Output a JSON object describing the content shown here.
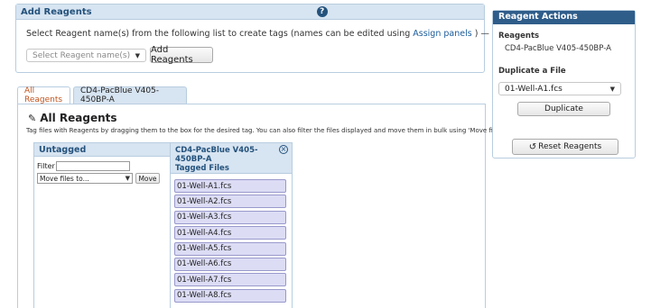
{
  "add_panel": {
    "title": "Add Reagents",
    "help_icon": "?",
    "instruction_prefix": "Select Reagent name(s) from the following list to create tags (names can be edited using ",
    "instruction_link": "Assign panels",
    "instruction_suffix": " ) —",
    "select_placeholder": "Select Reagent name(s)",
    "add_button": "Add Reagents"
  },
  "tabs": [
    {
      "label": "All Reagents",
      "active": true
    },
    {
      "label": "CD4-PacBlue V405-450BP-A",
      "active": false
    }
  ],
  "main": {
    "title": "All Reagents",
    "description": "Tag files with Reagents by dragging them to the box for the desired tag. You can also filter the files displayed and move them in bulk using 'Move files to...'.",
    "untagged": {
      "title": "Untagged",
      "filter_label": "Filter",
      "filter_value": "",
      "move_select": "Move files to...",
      "move_button": "Move"
    },
    "tagged": {
      "title_line1": "CD4-PacBlue V405-450BP-A",
      "title_line2": "Tagged Files",
      "close_icon": "⊗",
      "files": [
        "01-Well-A1.fcs",
        "01-Well-A2.fcs",
        "01-Well-A3.fcs",
        "01-Well-A4.fcs",
        "01-Well-A5.fcs",
        "01-Well-A6.fcs",
        "01-Well-A7.fcs",
        "01-Well-A8.fcs"
      ]
    }
  },
  "actions": {
    "title": "Reagent Actions",
    "reagents_label": "Reagents",
    "reagent_value": "CD4-PacBlue V405-450BP-A",
    "duplicate_label": "Duplicate a File",
    "duplicate_select": "01-Well-A1.fcs",
    "duplicate_button": "Duplicate",
    "reset_button": "Reset Reagents"
  },
  "icons": {
    "pen": "pencil-icon",
    "reset": "undo-icon",
    "help": "help-icon",
    "close": "close-icon"
  },
  "colors": {
    "header_bg": "#d7e4f1",
    "header_text": "#24527c",
    "actions_header": "#2f5d8a",
    "active_tab_text": "#c0531d",
    "file_bg": "#dcdcf5"
  }
}
